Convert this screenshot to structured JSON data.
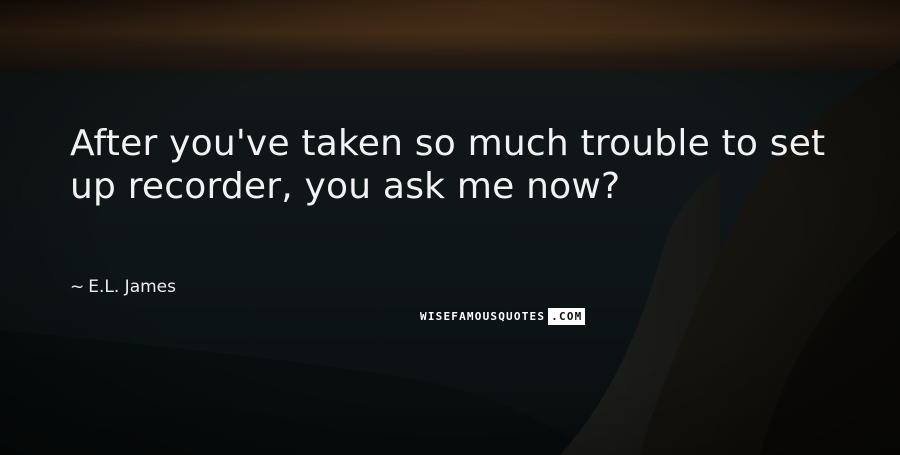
{
  "quote": {
    "text": "After you've taken so much trouble to set up recorder, you ask me now?",
    "author_dash": "~",
    "author": "E.L. James"
  },
  "watermark": {
    "main": "WISEFAMOUSQUOTES",
    "tld": ".COM"
  },
  "colors": {
    "text": "#f2f2f2",
    "sky_glow": "#8a5a2a",
    "sea": "#1a2326",
    "cliff": "#1c1a16"
  }
}
